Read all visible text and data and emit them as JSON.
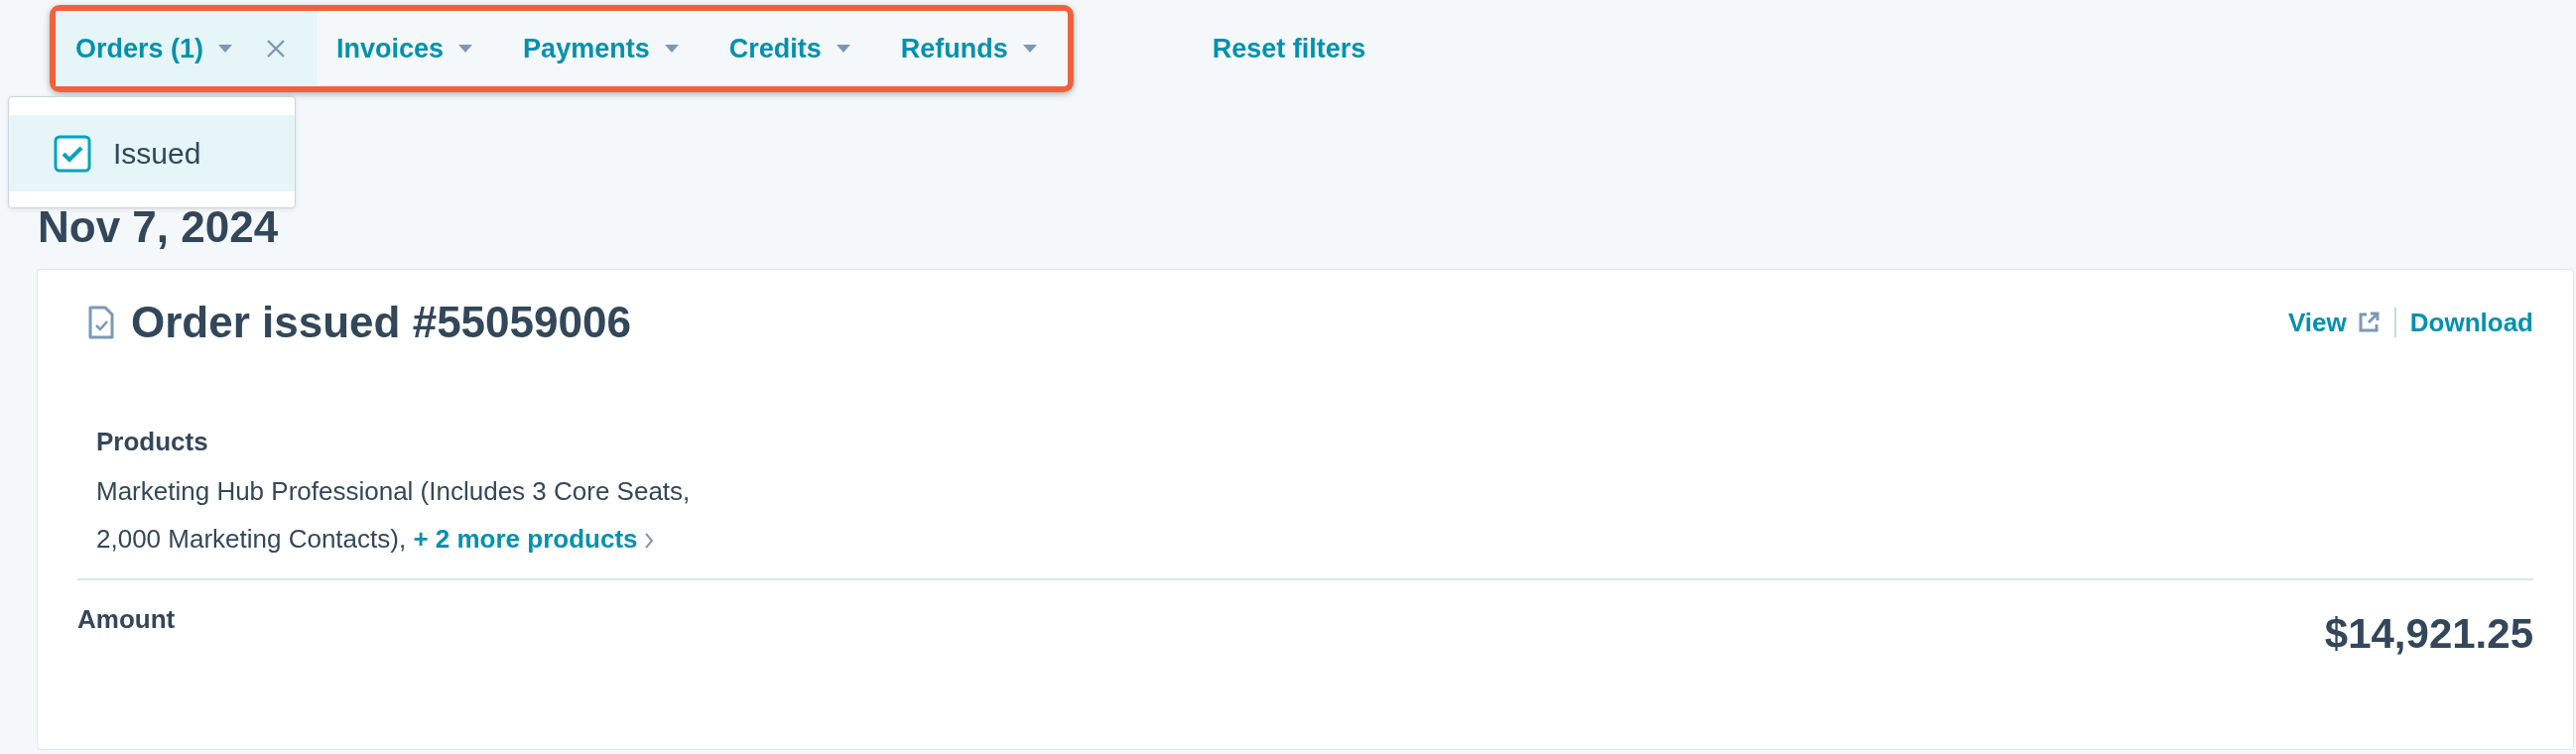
{
  "filter_bar": {
    "highlighted": true,
    "filters": [
      {
        "label": "Orders (1)",
        "open": true,
        "clearable": true
      },
      {
        "label": "Invoices",
        "open": false,
        "clearable": false
      },
      {
        "label": "Payments",
        "open": false,
        "clearable": false
      },
      {
        "label": "Credits",
        "open": false,
        "clearable": false
      },
      {
        "label": "Refunds",
        "open": false,
        "clearable": false
      }
    ]
  },
  "reset_link": "Reset filters",
  "dropdown": {
    "options": [
      {
        "label": "Issued",
        "checked": true
      }
    ]
  },
  "date_heading": "Nov 7, 2024",
  "order": {
    "title": "Order issued #55059006",
    "actions": [
      {
        "label": "View",
        "external": true
      },
      {
        "label": "Download",
        "external": false
      }
    ],
    "products_label": "Products",
    "products_text": "Marketing Hub Professional (Includes 3 Core Seats, 2,000 Marketing Contacts),",
    "more_link": "+ 2 more products",
    "amount_label": "Amount",
    "amount": "$14,921.25"
  }
}
